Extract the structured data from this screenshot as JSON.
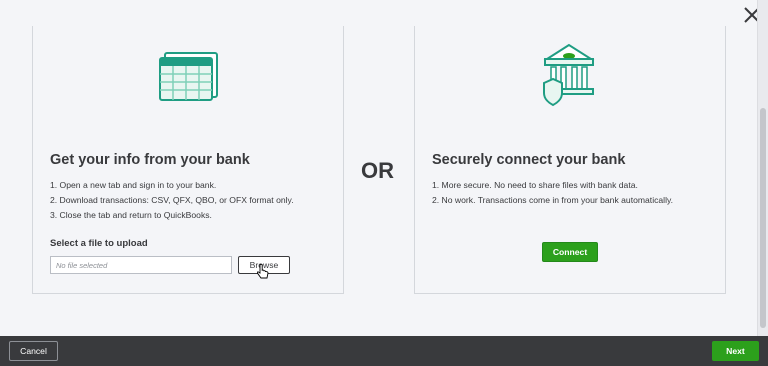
{
  "dialog": {
    "close_icon": "close-icon",
    "or_label": "OR"
  },
  "file_panel": {
    "icon": "spreadsheet-icon",
    "title": "Get your info from your bank",
    "steps": [
      "1.  Open a new tab and sign in to your bank.",
      "2.  Download transactions: CSV, QFX, QBO, or OFX format only.",
      "3.  Close the tab and return to QuickBooks."
    ],
    "upload_label": "Select a file to upload",
    "file_placeholder": "No file selected",
    "browse_label": "Browse"
  },
  "connect_panel": {
    "icon": "bank-shield-icon",
    "title": "Securely connect your bank",
    "steps": [
      "1.  More secure. No need to share files with bank data.",
      "2.  No work. Transactions come in from your bank automatically."
    ],
    "connect_label": "Connect"
  },
  "footer": {
    "cancel_label": "Cancel",
    "next_label": "Next"
  },
  "colors": {
    "accent_green": "#2ca01c",
    "icon_teal": "#1f9d83",
    "footer_bg": "#393a3d"
  }
}
